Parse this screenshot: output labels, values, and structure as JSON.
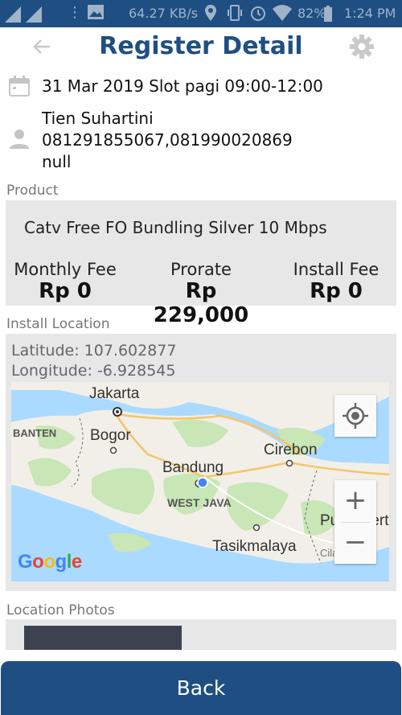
{
  "status_bar": {
    "network_speed": "64.27 KB/s",
    "battery": "82%",
    "time": "1:24 PM"
  },
  "header": {
    "title": "Register Detail",
    "back_icon": "arrow-left-icon",
    "settings_icon": "gear-icon"
  },
  "slot": {
    "text": "31 Mar 2019 Slot pagi 09:00-12:00"
  },
  "customer": {
    "name": "Tien Suhartini",
    "phones": "081291855067,081990020869",
    "extra": "null"
  },
  "product": {
    "section_label": "Product",
    "name": "Catv Free FO Bundling Silver 10 Mbps",
    "fees": [
      {
        "label": "Monthly Fee",
        "value": "Rp 0"
      },
      {
        "label": "Prorate",
        "value": "Rp 229,000"
      },
      {
        "label": "Install Fee",
        "value": "Rp 0"
      }
    ]
  },
  "install_location": {
    "section_label": "Install Location",
    "latitude": "Latitude: 107.602877",
    "longitude": "Longitude: -6.928545",
    "map": {
      "labels": {
        "jakarta": "Jakarta",
        "banten": "BANTEN",
        "bogor": "Bogor",
        "cirebon": "Cirebon",
        "bandung": "Bandung",
        "west_java": "WEST JAVA",
        "purwokerto": "Purwokert",
        "tasikmalaya": "Tasikmalaya",
        "cilacap": "Cilacap"
      },
      "zoom_in": "+",
      "zoom_out": "−",
      "attribution": [
        "G",
        "o",
        "o",
        "g",
        "l",
        "e"
      ]
    }
  },
  "location_photos": {
    "section_label": "Location Photos"
  },
  "footer": {
    "back_label": "Back"
  },
  "colors": {
    "primary": "#1f4f82",
    "panel": "#e7e7e7",
    "map_water": "#aadaff",
    "map_land": "#f2efe9",
    "map_green": "#c8e6b6",
    "location_dot": "#4285f4"
  }
}
